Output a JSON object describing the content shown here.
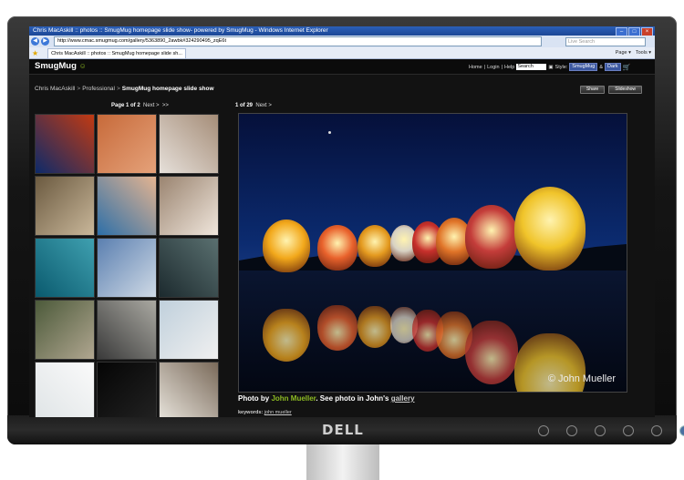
{
  "browser": {
    "title": "Chris MacAskill :: photos :: SmugMug homepage slide show- powered by SmugMug - Windows Internet Explorer",
    "url": "http://www.cmac.smugmug.com/gallery/5363890_2awbk#324290495_zqE6t",
    "search_placeholder": "Live Search",
    "tab_title": "Chris MacAskill :: photos :: SmugMug homepage slide sh...",
    "tools": [
      "Page ▾",
      "Tools ▾"
    ]
  },
  "smugmug": {
    "logo": "SmugMug",
    "links": [
      "Home",
      "Login",
      "Help"
    ],
    "search_value": "Search",
    "style_label": "Style:",
    "style_value": "SmugMug",
    "amp": "&",
    "theme_value": "Dark",
    "breadcrumb": {
      "owner": "Chris MacAskill",
      "category": "Professional",
      "gallery": "SmugMug homepage slide show"
    },
    "share_label": "Share",
    "slideshow_label": "Slideshow",
    "pager": {
      "label": "Page 1 of 2",
      "next": "Next >",
      "last": ">>"
    },
    "counter": {
      "label": "1 of 29",
      "next": "Next >"
    },
    "caption": {
      "prefix": "Photo by ",
      "name": "John Mueller",
      "middle": ". See photo in John's ",
      "link": "gallery"
    },
    "photo_credit": "© John Mueller",
    "keywords_label": "keywords:",
    "keywords": "john mueller"
  },
  "monitor": {
    "brand": "DELL"
  },
  "thumb_colors": [
    [
      "#0d2a6a",
      "#c23a12"
    ],
    [
      "#c76a3a",
      "#e5a27a"
    ],
    [
      "#e6e0da",
      "#a58d78"
    ],
    [
      "#6b5a40",
      "#c9b79a"
    ],
    [
      "#2d6fa8",
      "#e4b490"
    ],
    [
      "#9a8470",
      "#f0e6dc"
    ],
    [
      "#0a5a6e",
      "#3fa0b0"
    ],
    [
      "#5a7fb0",
      "#d0dae6"
    ],
    [
      "#1c2a2e",
      "#5a7070"
    ],
    [
      "#4c5a3a",
      "#b0a690"
    ],
    [
      "#3a3a3a",
      "#aaa9a2"
    ],
    [
      "#c0d0dc",
      "#f0f0f0"
    ],
    [
      "#dfe4e6",
      "#fafafa"
    ],
    [
      "#050505",
      "#222222"
    ],
    [
      "#e8e4dc",
      "#7a6a5a"
    ]
  ],
  "balloon_colors": [
    "#f2a81b",
    "#e9622c",
    "#e49a1f",
    "#d8d2c4",
    "#c7302c",
    "#e07428",
    "#c43d3a",
    "#f0c42a"
  ]
}
